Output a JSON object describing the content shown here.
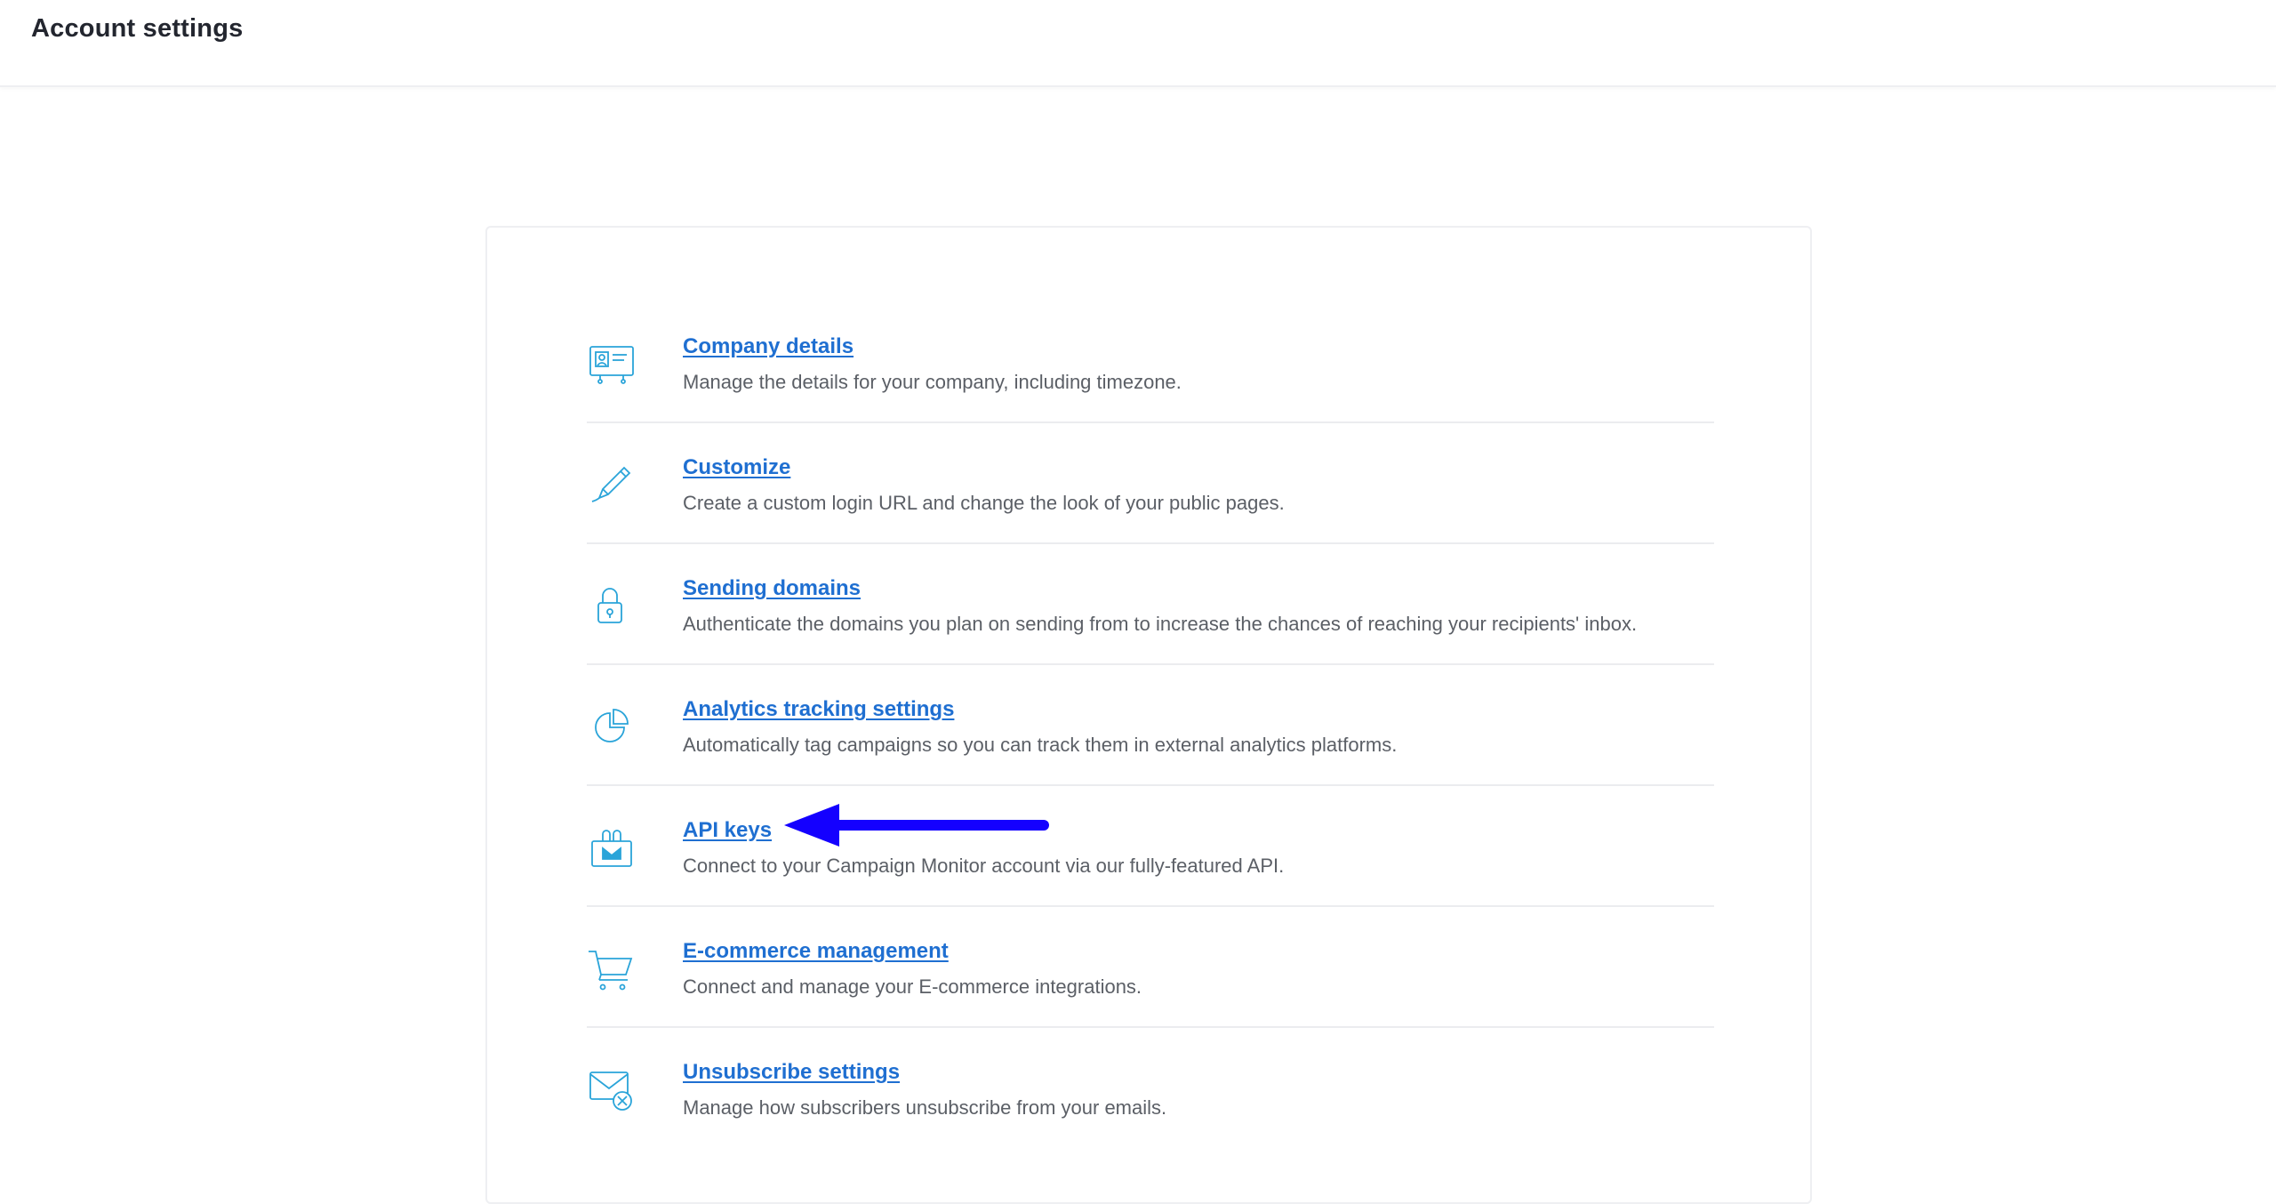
{
  "header": {
    "title": "Account settings"
  },
  "settings": {
    "items": [
      {
        "title": "Company details",
        "description": "Manage the details for your company, including timezone.",
        "icon": "id-card-icon"
      },
      {
        "title": "Customize",
        "description": "Create a custom login URL and change the look of your public pages.",
        "icon": "pencil-icon"
      },
      {
        "title": "Sending domains",
        "description": "Authenticate the domains you plan on sending from to increase the chances of reaching your recipients' inbox.",
        "icon": "lock-icon"
      },
      {
        "title": "Analytics tracking settings",
        "description": "Automatically tag campaigns so you can track them in external analytics platforms.",
        "icon": "pie-chart-icon"
      },
      {
        "title": "API keys",
        "description": "Connect to your Campaign Monitor account via our fully-featured API.",
        "icon": "api-plug-icon"
      },
      {
        "title": "E-commerce management",
        "description": "Connect and manage your E-commerce integrations.",
        "icon": "shopping-cart-icon"
      },
      {
        "title": "Unsubscribe settings",
        "description": "Manage how subscribers unsubscribe from your emails.",
        "icon": "envelope-unsubscribe-icon"
      }
    ]
  },
  "colors": {
    "link": "#1f6fd1",
    "icon": "#2aa4d9",
    "annotation_arrow": "#1400ff"
  }
}
